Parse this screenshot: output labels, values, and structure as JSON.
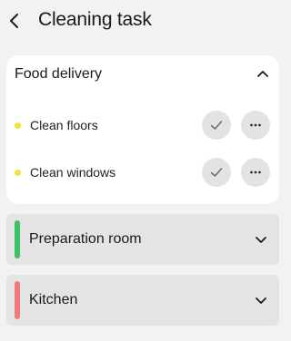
{
  "header": {
    "title": "Cleaning task",
    "back_icon": "chevron-left-icon"
  },
  "expanded_section": {
    "title": "Food delivery",
    "toggle_icon": "chevron-up-icon",
    "tasks": [
      {
        "label": "Clean floors",
        "dot_color": "#f2e535",
        "check_icon": "check-icon",
        "more_icon": "more-horizontal-icon"
      },
      {
        "label": "Clean windows",
        "dot_color": "#f2e535",
        "check_icon": "check-icon",
        "more_icon": "more-horizontal-icon"
      }
    ]
  },
  "collapsed_sections": [
    {
      "title": "Preparation room",
      "accent_color": "#3cc26a",
      "toggle_icon": "chevron-down-icon"
    },
    {
      "title": "Kitchen",
      "accent_color": "#f07a7a",
      "toggle_icon": "chevron-down-icon"
    }
  ]
}
